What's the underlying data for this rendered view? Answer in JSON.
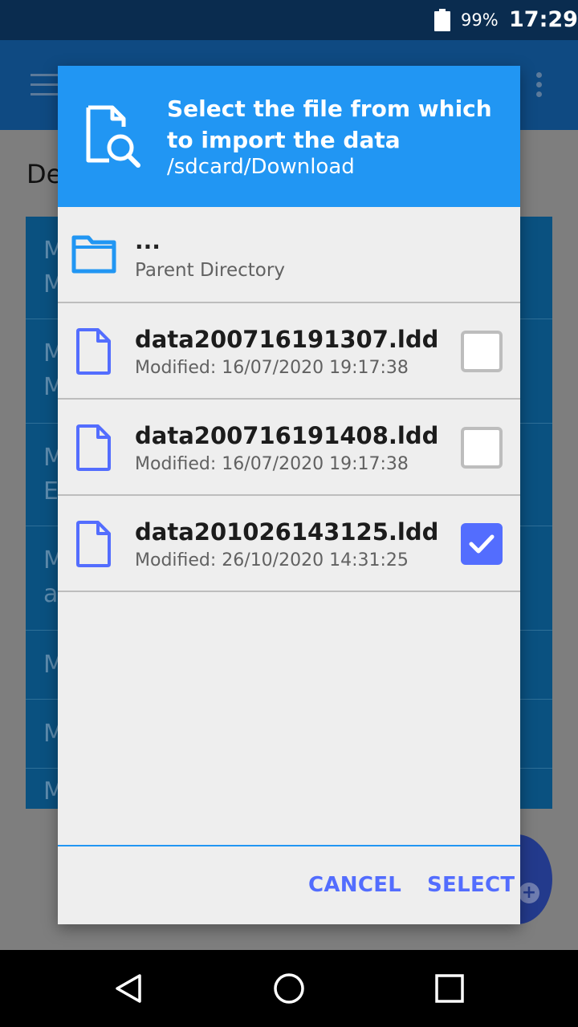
{
  "status_bar": {
    "battery": "99%",
    "time": "17:29",
    "battery_icon": "battery-icon"
  },
  "background_app": {
    "heading": "De",
    "rows": [
      "M\nM",
      "M\nM",
      "M\nE",
      "M\na",
      "M",
      "M",
      "M"
    ]
  },
  "dialog": {
    "title": "Select the file from which to import the data",
    "path": "/sdcard/Download",
    "parent": {
      "name": "...",
      "label": "Parent Directory"
    },
    "files": [
      {
        "name": "data200716191307.ldd",
        "modified": "Modified: 16/07/2020 19:17:38",
        "checked": false
      },
      {
        "name": "data200716191408.ldd",
        "modified": "Modified: 16/07/2020 19:17:38",
        "checked": false
      },
      {
        "name": "data201026143125.ldd",
        "modified": "Modified: 26/10/2020 14:31:25",
        "checked": true
      }
    ],
    "cancel_label": "CANCEL",
    "select_label": "SELECT"
  },
  "colors": {
    "header": "#2196f3",
    "accent": "#536dfe",
    "file_icon": "#536dfe",
    "folder_icon": "#2196f3"
  }
}
